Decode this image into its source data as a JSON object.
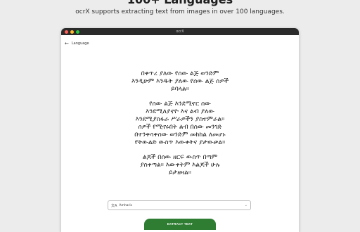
{
  "promo": {
    "title": "100+ Languages",
    "subtitle": "ocrX supports extracting text from images in over 100 languages."
  },
  "window": {
    "title": "ocrX",
    "traffic_lights": [
      "#ff5f57",
      "#febc2e",
      "#28c840"
    ]
  },
  "appbar": {
    "back_icon": "arrow-back-icon",
    "label": "Language"
  },
  "ocr_text": [
    "በቀጥረ ያለው የሰው ልጅ ወንድም\nእንዲሁም እንዱት ያለው የሰው ልጅ ሰዎች\nይባላል።",
    "የሰው ልጅ እንደሚኖር ሰው\nእንደሚለያኖዮ እና ልብ ያለው\nእንደሚያስፋራ ሥራዎችን ያስተምራል።\nሰዎች የሚኖሩበት ልብ በሰው መንገድ\nበተንቀሳቀሰው ወንድም መከከል ለመሆኑ\nየትውልድ ውስጥ እውቀትና ያታውቃል።",
    "ልጆች በሰው ዘርፍ ውስጥ በጣም\nያስቀጣል። እውቀትም እልጆች ሁሉ\nይታዘዛል።"
  ],
  "language_select": {
    "icon": "translate-icon",
    "value": "Amharic",
    "dropdown_icon": "chevron-down-icon"
  },
  "extract_button": {
    "label": "EXTRACT TEXT",
    "color": "#2e7d32"
  }
}
